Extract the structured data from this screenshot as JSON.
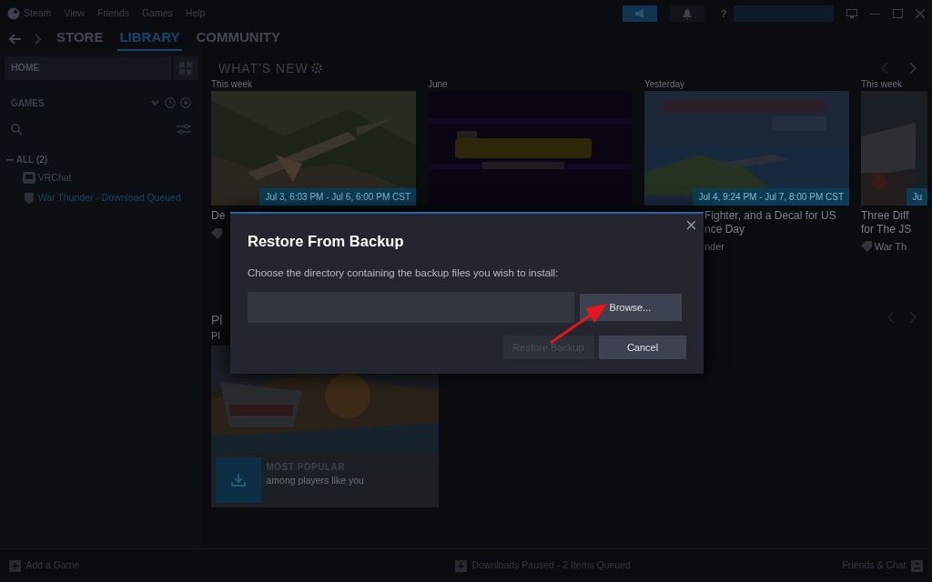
{
  "menu": [
    "Steam",
    "View",
    "Friends",
    "Games",
    "Help"
  ],
  "help_button": "?",
  "nav_tabs": [
    {
      "label": "STORE",
      "selected": false
    },
    {
      "label": "LIBRARY",
      "selected": true
    },
    {
      "label": "COMMUNITY",
      "selected": false
    }
  ],
  "sidebar": {
    "home": "HOME",
    "section": "GAMES",
    "group": {
      "label": "ALL",
      "count": "(2)",
      "expanded": true,
      "children": [
        {
          "name": "VRChat",
          "queued": false
        },
        {
          "name": "War Thunder - Download Queued",
          "queued": true
        }
      ]
    }
  },
  "whats_new": {
    "title": "WHAT'S NEW",
    "cards": [
      {
        "period": "This week",
        "date": "Jul 3, 6:03 PM - Jul 6, 6:00 PM CST",
        "caption": [
          "De"
        ]
      },
      {
        "period": "June"
      },
      {
        "period": "Yesterday",
        "date": "Jul 4, 9:24 PM - Jul 7, 8:00 PM CST",
        "caption": [
          "Fighter, and a Decal for US",
          "nce Day"
        ],
        "source": "nder"
      },
      {
        "period": "This week",
        "date": "Ju",
        "caption": [
          "Three Diff",
          "for The JS"
        ],
        "source": "War Th"
      }
    ]
  },
  "play_next": {
    "title": "Pl",
    "subtitle": "Pl"
  },
  "tile": {
    "label": "MOST POPULAR",
    "sub": "among players like you"
  },
  "dialog": {
    "title": "Restore From Backup",
    "description": "Choose the directory containing the backup files you wish to install:",
    "browse": "Browse...",
    "buttons": [
      {
        "label": "Restore Backup",
        "disabled": true
      },
      {
        "label": "Cancel",
        "disabled": false
      }
    ]
  },
  "status_bar": {
    "add_game": "Add a Game",
    "downloads": "Downloads Paused - 2 Items Queued",
    "friends": "Friends & Chat"
  }
}
